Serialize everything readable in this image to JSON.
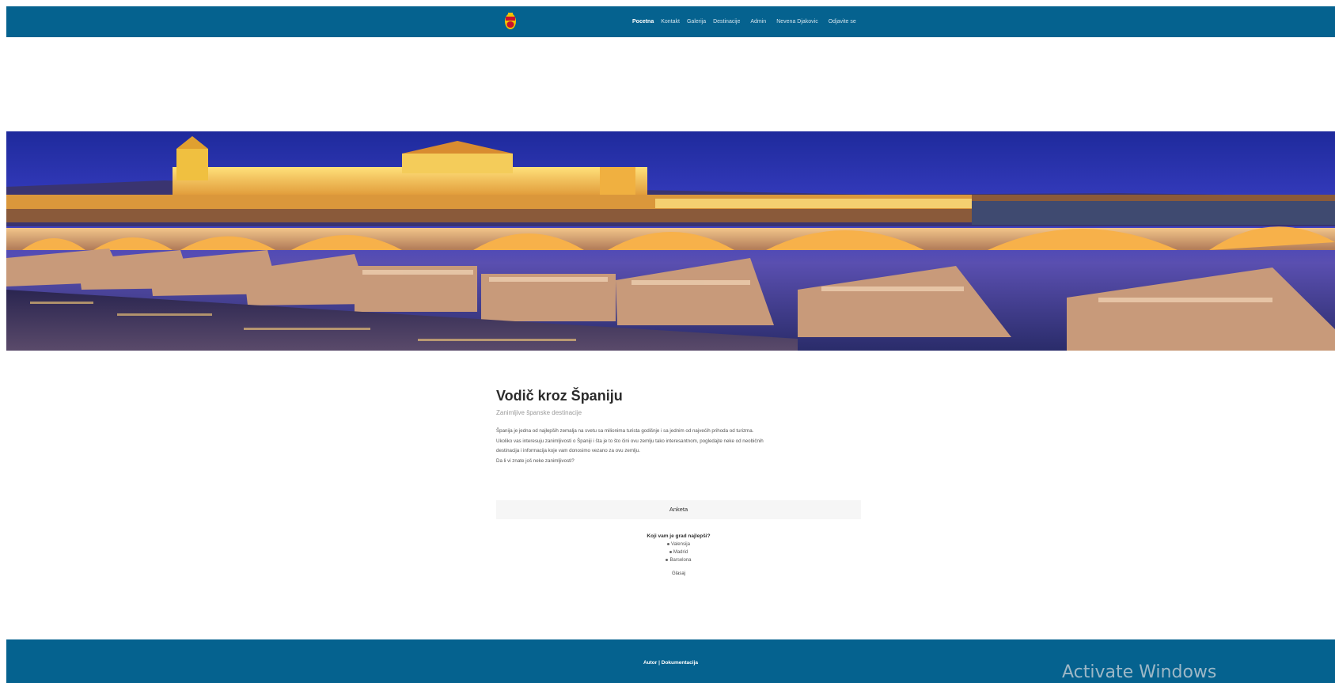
{
  "nav": {
    "items": [
      {
        "label": "Pocetna",
        "active": true
      },
      {
        "label": "Kontakt"
      },
      {
        "label": "Galerija"
      },
      {
        "label": "Destinacije"
      },
      {
        "label": "Admin"
      },
      {
        "label": "Nevena Djakovic"
      },
      {
        "label": "Odjavite se"
      }
    ]
  },
  "hero": {
    "icon": "night-bridge-cityscape-image"
  },
  "main": {
    "title": "Vodič kroz Španiju",
    "subtitle": "Zanimljive španske destinacije",
    "paragraphs": [
      "Španija je jedna od najlepših zemalja na svetu sa milionima turista godišnje i sa jednim od najvećih prihoda od turizma.",
      "Ukoliko vas interesuju zanimljivosti o Španiji i šta je to što čini ovu zemlju tako interesantnom, pogledajte neke od neobičnih",
      "destinacija i informacija koje vam donosimo vezano za ovu zemlju.",
      "Da li vi znate još neke zanimljivosti?"
    ]
  },
  "poll": {
    "header": "Anketa",
    "question": "Koji vam je grad najlepši?",
    "options": [
      "Valensija",
      "Madrid",
      "Barselona"
    ],
    "vote_label": "Glasaj"
  },
  "footer": {
    "author": "Autor",
    "separator": "|",
    "docs": "Dokumentacija"
  },
  "watermark": "Activate Windows",
  "colors": {
    "navbar": "#05628f",
    "footer": "#05628f",
    "accent_white": "#ffffff"
  }
}
